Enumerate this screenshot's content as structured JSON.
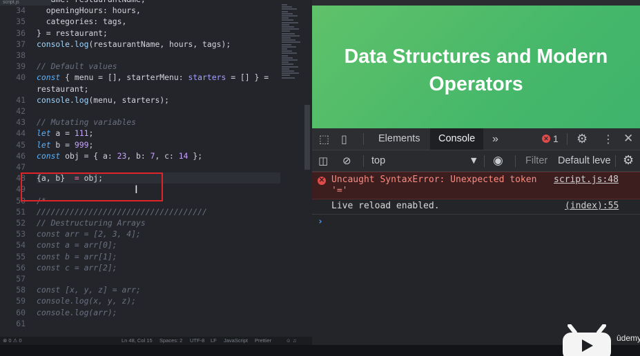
{
  "editor": {
    "tab_label": "script.js",
    "lines": [
      {
        "n": "",
        "tokens": [
          [
            "p",
            "  name: restaurantName,"
          ]
        ]
      },
      {
        "n": "34",
        "tokens": [
          [
            "p",
            "  openingHours: hours,"
          ]
        ]
      },
      {
        "n": "35",
        "tokens": [
          [
            "p",
            "  categories: tags,"
          ]
        ]
      },
      {
        "n": "36",
        "tokens": [
          [
            "p",
            "} = restaurant;"
          ]
        ]
      },
      {
        "n": "37",
        "tokens": [
          [
            "f",
            "console"
          ],
          [
            "p",
            "."
          ],
          [
            "f",
            "log"
          ],
          [
            "p",
            "(restaurantName, hours, tags);"
          ]
        ]
      },
      {
        "n": "38",
        "tokens": []
      },
      {
        "n": "39",
        "tokens": [
          [
            "c",
            "// Default values"
          ]
        ]
      },
      {
        "n": "40",
        "tokens": [
          [
            "k",
            "const"
          ],
          [
            "p",
            " { menu = [], starterMenu: "
          ],
          [
            "pv",
            "starters"
          ],
          [
            "p",
            " = [] } ="
          ]
        ]
      },
      {
        "n": "",
        "tokens": [
          [
            "p",
            "restaurant;"
          ]
        ]
      },
      {
        "n": "41",
        "tokens": [
          [
            "f",
            "console"
          ],
          [
            "p",
            "."
          ],
          [
            "f",
            "log"
          ],
          [
            "p",
            "(menu, starters);"
          ]
        ]
      },
      {
        "n": "42",
        "tokens": []
      },
      {
        "n": "43",
        "tokens": [
          [
            "c",
            "// Mutating variables"
          ]
        ]
      },
      {
        "n": "44",
        "tokens": [
          [
            "k",
            "let"
          ],
          [
            "p",
            " a = "
          ],
          [
            "n",
            "111"
          ],
          [
            "p",
            ";"
          ]
        ]
      },
      {
        "n": "45",
        "tokens": [
          [
            "k",
            "let"
          ],
          [
            "p",
            " b = "
          ],
          [
            "n",
            "999"
          ],
          [
            "p",
            ";"
          ]
        ]
      },
      {
        "n": "46",
        "tokens": [
          [
            "k",
            "const"
          ],
          [
            "p",
            " obj = { a: "
          ],
          [
            "n",
            "23"
          ],
          [
            "p",
            ", b: "
          ],
          [
            "n",
            "7"
          ],
          [
            "p",
            ", c: "
          ],
          [
            "n",
            "14"
          ],
          [
            "p",
            " };"
          ]
        ]
      },
      {
        "n": "47",
        "tokens": []
      },
      {
        "n": "48",
        "tokens": [
          [
            "p",
            "{a, b}  "
          ],
          [
            "o",
            "="
          ],
          [
            "p",
            " obj;"
          ]
        ],
        "current": true
      },
      {
        "n": "49",
        "tokens": []
      },
      {
        "n": "50",
        "tokens": [
          [
            "ci",
            "/*"
          ]
        ]
      },
      {
        "n": "51",
        "tokens": [
          [
            "ci",
            "////////////////////////////////////"
          ]
        ]
      },
      {
        "n": "52",
        "tokens": [
          [
            "ci",
            "// Destructuring Arrays"
          ]
        ]
      },
      {
        "n": "53",
        "tokens": [
          [
            "ci",
            "const arr = [2, 3, 4];"
          ]
        ]
      },
      {
        "n": "54",
        "tokens": [
          [
            "ci",
            "const a = arr[0];"
          ]
        ]
      },
      {
        "n": "55",
        "tokens": [
          [
            "ci",
            "const b = arr[1];"
          ]
        ]
      },
      {
        "n": "56",
        "tokens": [
          [
            "ci",
            "const c = arr[2];"
          ]
        ]
      },
      {
        "n": "57",
        "tokens": []
      },
      {
        "n": "58",
        "tokens": [
          [
            "ci",
            "const [x, y, z] = arr;"
          ]
        ]
      },
      {
        "n": "59",
        "tokens": [
          [
            "ci",
            "console.log(x, y, z);"
          ]
        ]
      },
      {
        "n": "60",
        "tokens": [
          [
            "ci",
            "console.log(arr);"
          ]
        ]
      },
      {
        "n": "61",
        "tokens": []
      }
    ],
    "status": {
      "left": "⊗ 0  ⚠ 0",
      "position": "Ln 48, Col 15",
      "spaces": "Spaces: 2",
      "encoding": "UTF-8",
      "eol": "LF",
      "language": "JavaScript",
      "formatter": "Prettier"
    }
  },
  "page": {
    "title": "Data Structures and Modern Operators"
  },
  "devtools": {
    "tabs": [
      "Elements",
      "Console"
    ],
    "active_tab": "Console",
    "more": "»",
    "error_count": "1",
    "toolbar": {
      "context": "top",
      "filter_placeholder": "Filter",
      "levels": "Default leve"
    },
    "messages": [
      {
        "type": "error",
        "text": "Uncaught SyntaxError: Unexpected token\n'='",
        "source": "script.js:48"
      },
      {
        "type": "log",
        "text": "Live reload enabled.",
        "source": "(index):55"
      }
    ],
    "prompt": "›"
  },
  "watermark": "ûdemy",
  "colors": {
    "editor_bg": "#23252b",
    "page_green": "#4fbb6a",
    "error_red": "#e34a4a",
    "highlight_box": "#e0242a"
  }
}
